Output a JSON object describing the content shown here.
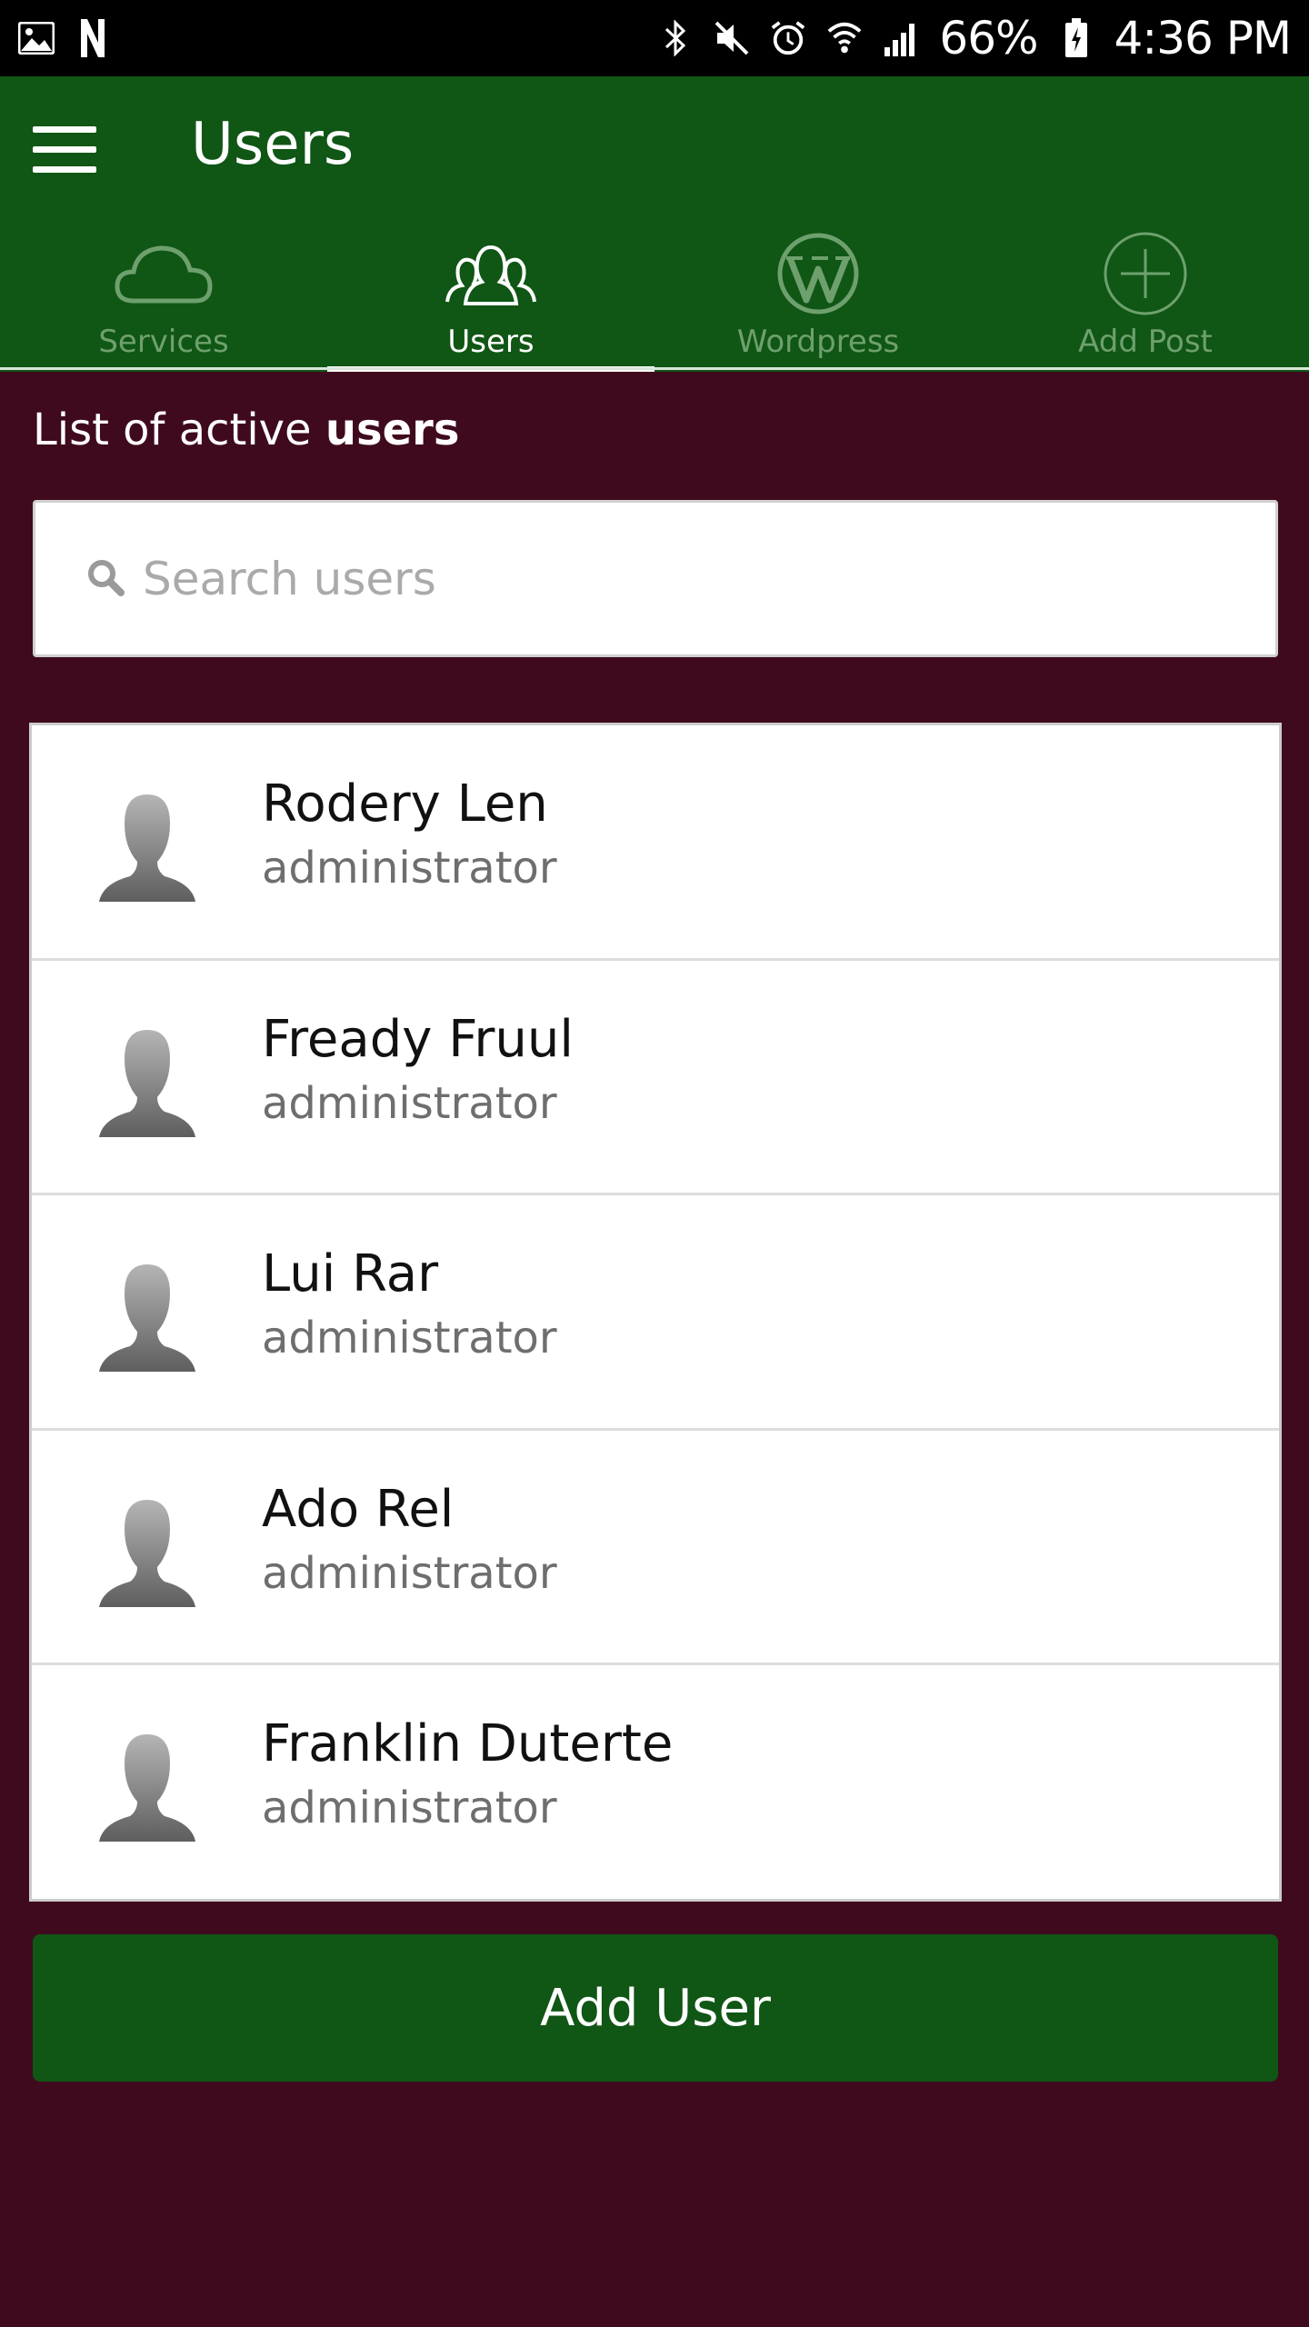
{
  "status_bar": {
    "battery": "66%",
    "time": "4:36 PM",
    "icons": [
      "gallery-icon",
      "netflix-icon",
      "bluetooth-icon",
      "mute-icon",
      "alarm-icon",
      "wifi-icon",
      "signal-icon",
      "battery-icon"
    ]
  },
  "app_bar": {
    "title": "Users",
    "menu_icon": "hamburger-menu-icon"
  },
  "tabs": [
    {
      "label": "Services",
      "icon": "cloud-icon",
      "active": false
    },
    {
      "label": "Users",
      "icon": "users-group-icon",
      "active": true
    },
    {
      "label": "Wordpress",
      "icon": "wordpress-icon",
      "active": false
    },
    {
      "label": "Add Post",
      "icon": "add-circle-icon",
      "active": false
    }
  ],
  "main": {
    "heading_prefix": "List of active ",
    "heading_bold": "users",
    "search": {
      "placeholder": "Search users",
      "value": ""
    },
    "users": [
      {
        "name": "Rodery Len",
        "role": "administrator"
      },
      {
        "name": "Fready Fruul",
        "role": "administrator"
      },
      {
        "name": "Lui Rar",
        "role": "administrator"
      },
      {
        "name": "Ado Rel",
        "role": "administrator"
      },
      {
        "name": "Franklin Duterte",
        "role": "administrator"
      }
    ],
    "add_button_label": "Add User"
  },
  "colors": {
    "app_bar": "#105615",
    "background": "#3f0a1e",
    "inactive_tab": "#6ea06e"
  }
}
